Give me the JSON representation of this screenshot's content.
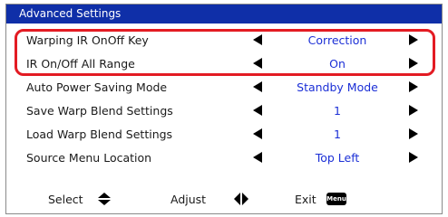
{
  "header": {
    "title": "Advanced Settings"
  },
  "settings": [
    {
      "label": "Warping IR OnOff Key",
      "value": "Correction"
    },
    {
      "label": "IR On/Off All Range",
      "value": "On"
    },
    {
      "label": "Auto Power Saving Mode",
      "value": "Standby Mode"
    },
    {
      "label": "Save Warp Blend Settings",
      "value": "1"
    },
    {
      "label": "Load Warp Blend Settings",
      "value": "1"
    },
    {
      "label": "Source Menu Location",
      "value": "Top Left"
    }
  ],
  "footer": {
    "select_label": "Select",
    "adjust_label": "Adjust",
    "exit_label": "Exit",
    "menu_badge": "Menu"
  },
  "icons": {
    "left": "triangle-left-icon",
    "right": "triangle-right-icon",
    "updown": "up-down-arrows-icon",
    "leftright": "left-right-arrows-icon"
  },
  "colors": {
    "titlebar": "#0f2fa8",
    "value_text": "#1b2fd6",
    "highlight": "#e31b23"
  }
}
